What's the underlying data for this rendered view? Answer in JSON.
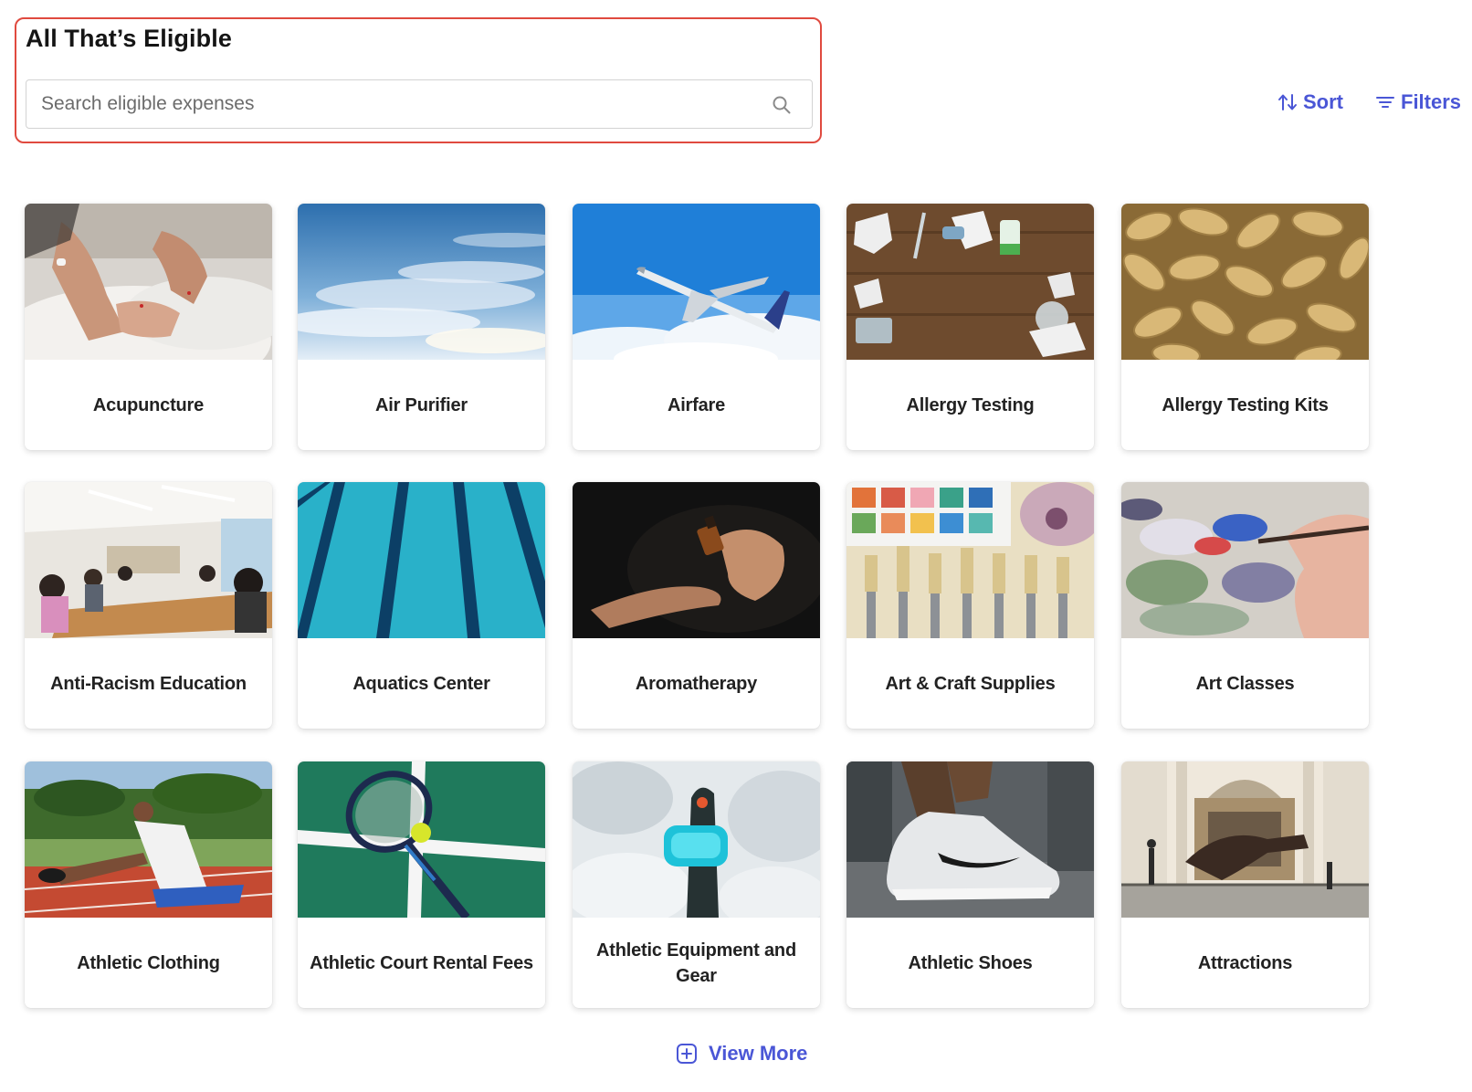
{
  "header": {
    "title": "All That’s Eligible",
    "search_placeholder": "Search eligible expenses",
    "search_icon": "search-icon"
  },
  "toolbar": {
    "sort_label": "Sort",
    "sort_icon": "sort-arrows-icon",
    "filters_label": "Filters",
    "filters_icon": "filter-lines-icon"
  },
  "items": [
    {
      "label": "Acupuncture",
      "image": "acupuncture-photo"
    },
    {
      "label": "Air Purifier",
      "image": "sky-photo"
    },
    {
      "label": "Airfare",
      "image": "airplane-photo"
    },
    {
      "label": "Allergy Testing",
      "image": "tissues-medicine-photo"
    },
    {
      "label": "Allergy Testing Kits",
      "image": "peanuts-photo"
    },
    {
      "label": "Anti-Racism Education",
      "image": "conference-room-photo"
    },
    {
      "label": "Aquatics Center",
      "image": "pool-lanes-photo"
    },
    {
      "label": "Aromatherapy",
      "image": "essential-oil-hands-photo"
    },
    {
      "label": "Art & Craft Supplies",
      "image": "paints-brushes-photo"
    },
    {
      "label": "Art Classes",
      "image": "palette-painting-photo"
    },
    {
      "label": "Athletic Clothing",
      "image": "track-stretch-photo"
    },
    {
      "label": "Athletic Court Rental Fees",
      "image": "tennis-racket-photo"
    },
    {
      "label": "Athletic Equipment and Gear",
      "image": "snow-goggles-photo"
    },
    {
      "label": "Athletic Shoes",
      "image": "sneaker-photo"
    },
    {
      "label": "Attractions",
      "image": "museum-dinosaur-photo"
    }
  ],
  "view_more": {
    "label": "View More",
    "icon": "plus-square-icon"
  },
  "colors": {
    "accent": "#4a56d6",
    "highlight_border": "#e04a3f",
    "title_text": "#151515"
  }
}
